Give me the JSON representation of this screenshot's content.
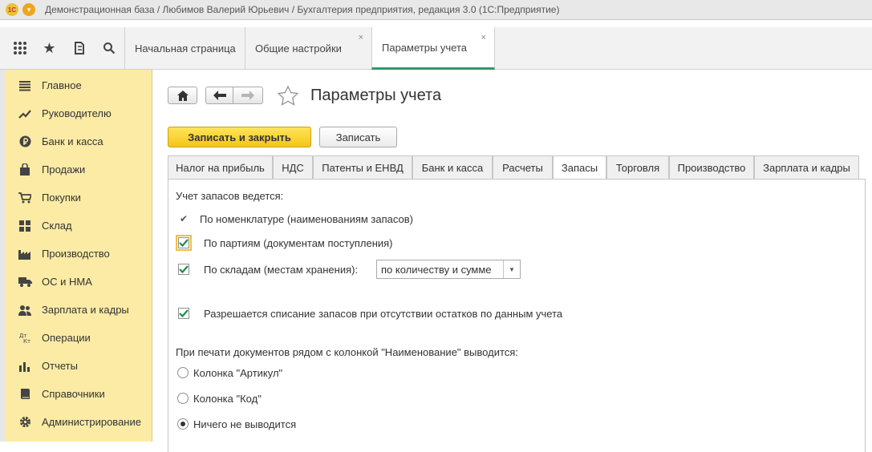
{
  "window": {
    "title": "Демонстрационная база / Любимов Валерий Юрьевич / Бухгалтерия предприятия, редакция 3.0  (1С:Предприятие)",
    "logo_text": "1С"
  },
  "open_tabs": [
    {
      "label": "Начальная страница"
    },
    {
      "label": "Общие настройки",
      "close": "×"
    },
    {
      "label": "Параметры учета",
      "close": "×"
    }
  ],
  "sidebar": {
    "items": [
      {
        "label": "Главное",
        "icon": "menu-lines-icon"
      },
      {
        "label": "Руководителю",
        "icon": "trend-icon"
      },
      {
        "label": "Банк и касса",
        "icon": "ruble-coin-icon"
      },
      {
        "label": "Продажи",
        "icon": "shopping-bag-icon"
      },
      {
        "label": "Покупки",
        "icon": "cart-icon"
      },
      {
        "label": "Склад",
        "icon": "warehouse-grid-icon"
      },
      {
        "label": "Производство",
        "icon": "factory-icon"
      },
      {
        "label": "ОС и НМА",
        "icon": "truck-icon"
      },
      {
        "label": "Зарплата и кадры",
        "icon": "people-icon"
      },
      {
        "label": "Операции",
        "icon": "dt-kt-icon"
      },
      {
        "label": "Отчеты",
        "icon": "bar-chart-icon"
      },
      {
        "label": "Справочники",
        "icon": "book-icon"
      },
      {
        "label": "Администрирование",
        "icon": "gear-icon"
      }
    ]
  },
  "page": {
    "title": "Параметры учета",
    "save_close_label": "Записать и закрыть",
    "save_label": "Записать"
  },
  "tabs": [
    {
      "label": "Налог на прибыль"
    },
    {
      "label": "НДС"
    },
    {
      "label": "Патенты и ЕНВД"
    },
    {
      "label": "Банк и касса"
    },
    {
      "label": "Расчеты"
    },
    {
      "label": "Запасы"
    },
    {
      "label": "Торговля"
    },
    {
      "label": "Производство"
    },
    {
      "label": "Зарплата и кадры"
    }
  ],
  "inventory": {
    "heading": "Учет запасов ведется:",
    "by_nomenclature": "По номенклатуре (наименованиям запасов)",
    "by_batches": "По партиям (документам поступления)",
    "by_warehouses": "По складам (местам хранения):",
    "warehouse_mode": "по количеству и сумме",
    "allow_writeoff": "Разрешается списание запасов при отсутствии остатков по данным учета",
    "print_heading": "При печати документов рядом с колонкой \"Наименование\" выводится:",
    "radio_article": "Колонка \"Артикул\"",
    "radio_code": "Колонка \"Код\"",
    "radio_none": "Ничего не выводится"
  },
  "colors": {
    "accent_green": "#2e9a6b",
    "sidebar_bg": "#fbeba5",
    "primary_button": "#f5c518"
  }
}
